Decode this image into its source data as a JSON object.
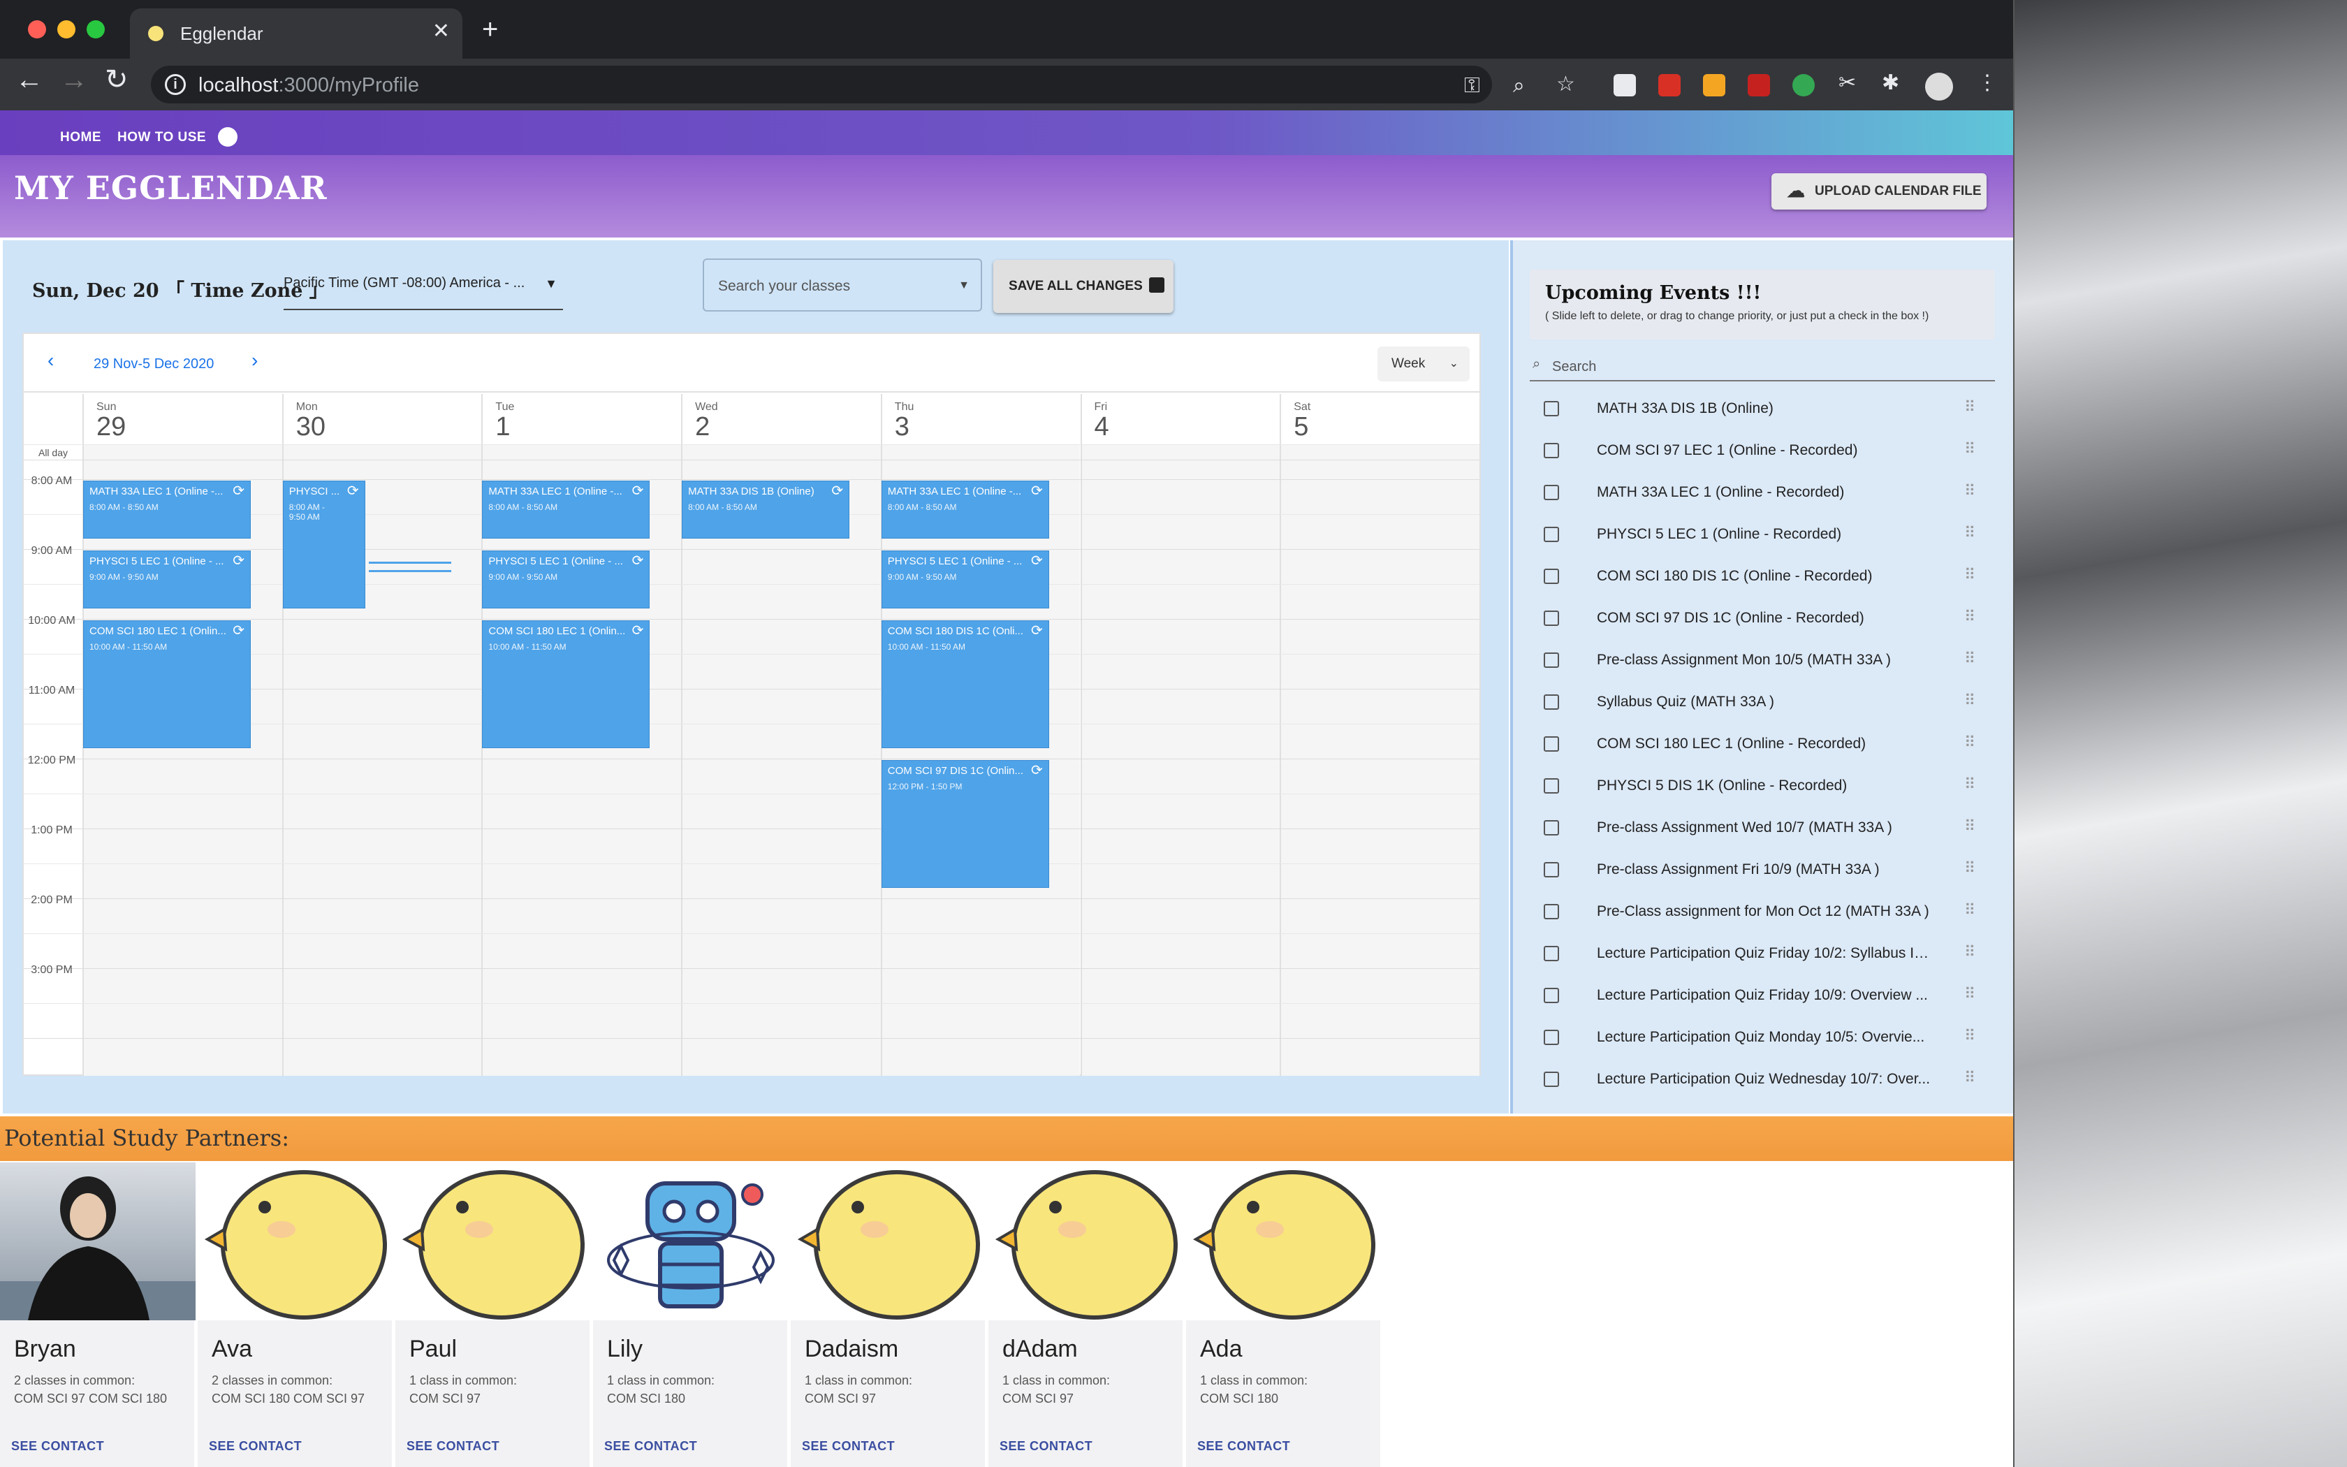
{
  "browser": {
    "tab_title": "Egglendar",
    "url_host": "localhost",
    "url_path": ":3000/myProfile"
  },
  "nav": {
    "home": "HOME",
    "how_to_use": "HOW TO USE"
  },
  "header": {
    "title": "MY EGGLENDAR",
    "upload_label": "UPLOAD CALENDAR FILE"
  },
  "controls": {
    "date_line": "Sun, Dec 20 「 Time Zone 」",
    "timezone": "Pacific Time (GMT -08:00) America - ...",
    "search_placeholder": "Search your classes",
    "save_label": "SAVE ALL CHANGES"
  },
  "calendar": {
    "range": "29 Nov-5 Dec 2020",
    "view": "Week",
    "allday_label": "All day",
    "days": [
      {
        "wd": "Sun",
        "dn": "29"
      },
      {
        "wd": "Mon",
        "dn": "30"
      },
      {
        "wd": "Tue",
        "dn": "1"
      },
      {
        "wd": "Wed",
        "dn": "2"
      },
      {
        "wd": "Thu",
        "dn": "3"
      },
      {
        "wd": "Fri",
        "dn": "4"
      },
      {
        "wd": "Sat",
        "dn": "5"
      }
    ],
    "times": [
      "8:00 AM",
      "9:00 AM",
      "10:00 AM",
      "11:00 AM",
      "12:00 PM",
      "1:00 PM",
      "2:00 PM",
      "3:00 PM"
    ],
    "events": [
      {
        "day": 0,
        "start": 8,
        "end": 8.833,
        "title": "MATH 33A LEC 1 (Online -...",
        "time": "8:00 AM - 8:50 AM"
      },
      {
        "day": 0,
        "start": 9,
        "end": 9.833,
        "title": "PHYSCI 5 LEC 1 (Online - ...",
        "time": "9:00 AM - 9:50 AM"
      },
      {
        "day": 0,
        "start": 10,
        "end": 11.833,
        "title": "COM SCI 180 LEC 1 (Onlin...",
        "time": "10:00 AM - 11:50 AM"
      },
      {
        "day": 1,
        "start": 8,
        "end": 9.833,
        "title": "PHYSCI ...",
        "time": "8:00 AM - 9:50 AM"
      },
      {
        "day": 2,
        "start": 8,
        "end": 8.833,
        "title": "MATH 33A LEC 1 (Online -...",
        "time": "8:00 AM - 8:50 AM"
      },
      {
        "day": 2,
        "start": 9,
        "end": 9.833,
        "title": "PHYSCI 5 LEC 1 (Online - ...",
        "time": "9:00 AM - 9:50 AM"
      },
      {
        "day": 2,
        "start": 10,
        "end": 11.833,
        "title": "COM SCI 180 LEC 1 (Onlin...",
        "time": "10:00 AM - 11:50 AM"
      },
      {
        "day": 3,
        "start": 8,
        "end": 8.833,
        "title": "MATH 33A DIS 1B (Online)",
        "time": "8:00 AM - 8:50 AM"
      },
      {
        "day": 4,
        "start": 8,
        "end": 8.833,
        "title": "MATH 33A LEC 1 (Online -...",
        "time": "8:00 AM - 8:50 AM"
      },
      {
        "day": 4,
        "start": 9,
        "end": 9.833,
        "title": "PHYSCI 5 LEC 1 (Online - ...",
        "time": "9:00 AM - 9:50 AM"
      },
      {
        "day": 4,
        "start": 10,
        "end": 11.833,
        "title": "COM SCI 180 DIS 1C (Onli...",
        "time": "10:00 AM - 11:50 AM"
      },
      {
        "day": 4,
        "start": 12,
        "end": 13.833,
        "title": "COM SCI 97 DIS 1C (Onlin...",
        "time": "12:00 PM - 1:50 PM"
      }
    ]
  },
  "upcoming": {
    "title": "Upcoming Events !!!",
    "subtitle": "( Slide left to delete, or drag to change priority, or just put a check in the box !)",
    "search_placeholder": "Search",
    "items": [
      "MATH 33A DIS 1B (Online)",
      "COM SCI 97 LEC 1 (Online - Recorded)",
      "MATH 33A LEC 1 (Online - Recorded)",
      "PHYSCI 5 LEC 1 (Online - Recorded)",
      "COM SCI 180 DIS 1C (Online - Recorded)",
      "COM SCI 97 DIS 1C (Online - Recorded)",
      "Pre-class Assignment Mon 10/5 (MATH 33A )",
      "Syllabus Quiz (MATH 33A )",
      "COM SCI 180 LEC 1 (Online - Recorded)",
      "PHYSCI 5 DIS 1K (Online - Recorded)",
      "Pre-class Assignment Wed 10/7 (MATH 33A )",
      "Pre-class Assignment Fri 10/9 (MATH 33A )",
      "Pre-Class assignment for Mon Oct 12 (MATH 33A )",
      "Lecture Participation Quiz Friday 10/2: Syllabus In...",
      "Lecture Participation Quiz Friday 10/9: Overview ...",
      "Lecture Participation Quiz Monday 10/5: Overvie...",
      "Lecture Participation Quiz Wednesday 10/7: Over..."
    ]
  },
  "partners": {
    "title": "Potential Study Partners:",
    "see_contact": "SEE CONTACT",
    "list": [
      {
        "name": "Bryan",
        "common": "2 classes in common:",
        "classes": "COM SCI 97 COM SCI 180",
        "avatar": "photo"
      },
      {
        "name": "Ava",
        "common": "2 classes in common:",
        "classes": "COM SCI 180 COM SCI 97",
        "avatar": "chick"
      },
      {
        "name": "Paul",
        "common": "1 class in common:",
        "classes": "COM SCI 97",
        "avatar": "chick"
      },
      {
        "name": "Lily",
        "common": "1 class in common:",
        "classes": "COM SCI 180",
        "avatar": "robot"
      },
      {
        "name": "Dadaism",
        "common": "1 class in common:",
        "classes": "COM SCI 97",
        "avatar": "chick"
      },
      {
        "name": "dAdam",
        "common": "1 class in common:",
        "classes": "COM SCI 97",
        "avatar": "chick"
      },
      {
        "name": "Ada",
        "common": "1 class in common:",
        "classes": "COM SCI 180",
        "avatar": "chick"
      }
    ]
  },
  "colors": {
    "event": "#4fa3e8",
    "appbar_start": "#6a3fbf",
    "appbar_end": "#5fc6d8",
    "partner_bar": "#f19a3e",
    "chick": "#f8e57c"
  }
}
